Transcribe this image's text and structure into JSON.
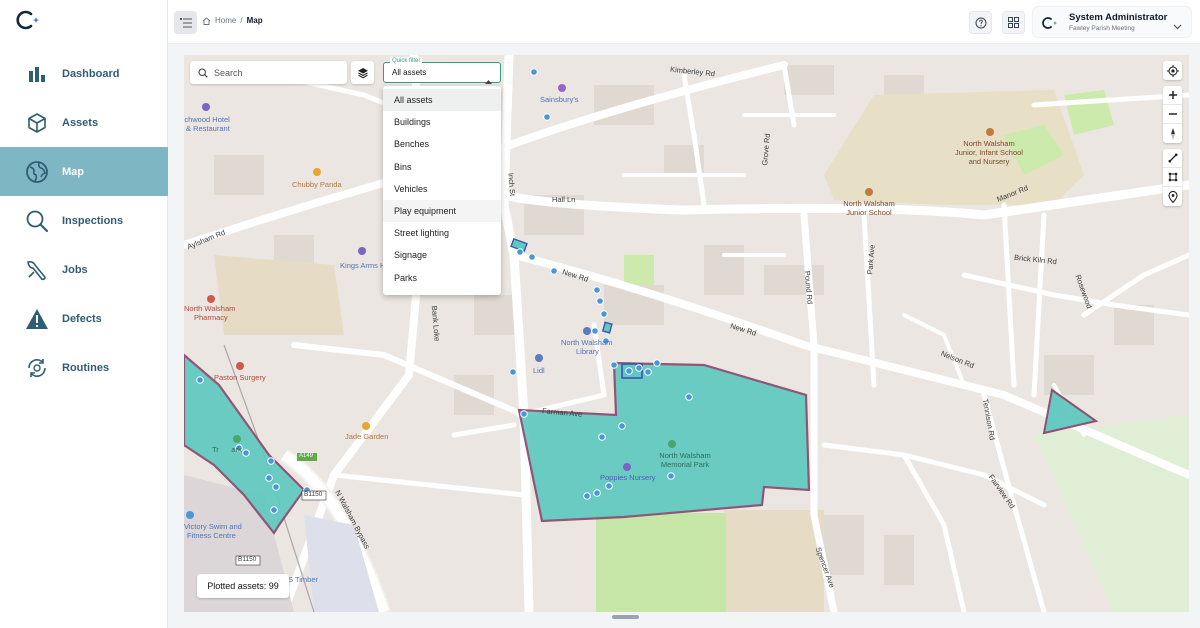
{
  "sidebar": {
    "items": [
      {
        "label": "Dashboard",
        "icon": "bar-chart-icon",
        "active": false
      },
      {
        "label": "Assets",
        "icon": "cube-icon",
        "active": false
      },
      {
        "label": "Map",
        "icon": "globe-icon",
        "active": true
      },
      {
        "label": "Inspections",
        "icon": "magnifier-icon",
        "active": false
      },
      {
        "label": "Jobs",
        "icon": "wrench-icon",
        "active": false
      },
      {
        "label": "Defects",
        "icon": "warning-icon",
        "active": false
      },
      {
        "label": "Routines",
        "icon": "refresh-icon",
        "active": false
      }
    ]
  },
  "header": {
    "breadcrumb": {
      "home": "Home",
      "separator": "/",
      "current": "Map"
    },
    "user": {
      "name": "System Administrator",
      "org": "Fawley Parish Meeting"
    }
  },
  "map": {
    "search_placeholder": "Search",
    "quick_filter": {
      "label": "Quick filter",
      "value": "All assets",
      "options": [
        "All assets",
        "Buildings",
        "Benches",
        "Bins",
        "Vehicles",
        "Play equipment",
        "Street lighting",
        "Signage",
        "Parks"
      ]
    },
    "plotted_assets": "Plotted assets: 99",
    "labels": {
      "kimberley_rd": "Kimberley Rd",
      "sainsburys": "Sainsbury's",
      "beechwood": "eechwood Hotel",
      "restaurant": "& Restaurant",
      "chubby_panda": "Chubby Panda",
      "hall_ln": "Hall Ln",
      "grove_rd": "Grove Rd",
      "north_walsham_junior": "North Walsham",
      "junior_infant": "Junior, Infant School",
      "and_nursery": "and Nursery",
      "north_walsham_junior2": "North Walsham",
      "junior_school": "Junior School",
      "manor_rd": "Manor Rd",
      "aylsham_rd": "Aylsham Rd",
      "kings_arms": "Kings Arms H",
      "new_rd1": "New Rd",
      "new_rd2": "New Rd",
      "pound_rd": "Pound Rd",
      "park_ave": "Park Ave",
      "brick_kiln_rd": "Brick Kiln Rd",
      "rosewood": "Rosewood",
      "nw_pharmacy": "North Walsham",
      "pharmacy": "Pharmacy",
      "bank_loke": "Bank Loke",
      "nw_library": "North Walsham",
      "library": "Library",
      "lidl": "Lidl",
      "paston_surgery": "Paston Surgery",
      "nelson_rd": "Nelson Rd",
      "farman_ave": "Farman Ave",
      "memorial_park1": "North Walsham",
      "memorial_park2": "Memorial Park",
      "poppies_nursery": "Poppies Nursery",
      "tennison_rd": "Tennison Rd",
      "jade_garden": "Jade Garden",
      "triangle_park": "Tr      ark",
      "a149": "A149",
      "b1150a": "B1150",
      "b1150b": "B1150",
      "nw_bypass": "N Walsham Bypass",
      "fairview_rd": "Fairview Rd",
      "victory_swim": "Victory Swim and",
      "fitness_centre": "Fitness Centre",
      "timber": "S Timber",
      "spencer_ave": "Spencer Ave",
      "inch_st": "Inch St"
    }
  },
  "colors": {
    "accent": "#7eb6c4",
    "nav_text": "#2f5d73",
    "polygon_fill": "#5fc9c0",
    "polygon_stroke": "#8a4a6e",
    "marker": "#4a97d6",
    "filter_border": "#3a9c84"
  }
}
